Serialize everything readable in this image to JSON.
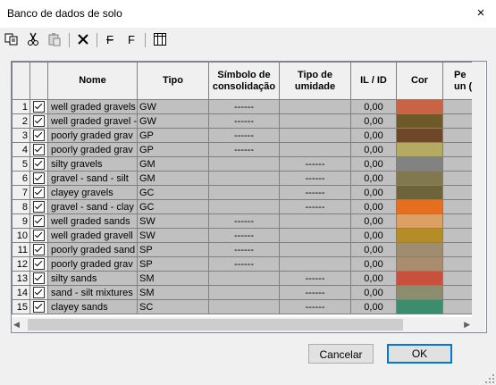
{
  "window": {
    "title": "Banco de dados de solo",
    "close_label": "×"
  },
  "toolbar": {
    "icons": [
      "copy-icon",
      "cut-icon",
      "paste-icon",
      "delete-icon",
      "filter-f-icon",
      "f-icon",
      "columns-icon"
    ],
    "f_label_1": "F",
    "f_label_2": "F"
  },
  "grid": {
    "headers": [
      "Nome",
      "Tipo",
      "Símbolo de consolidação",
      "Tipo de umidade",
      "IL / ID",
      "Cor",
      "Pe un (k"
    ],
    "rows": [
      {
        "n": "1",
        "nome": "well graded gravels",
        "tipo": "GW",
        "simb": "------",
        "umid": "",
        "il": "0,00",
        "cor": "#c86445"
      },
      {
        "n": "2",
        "nome": "well graded gravel -",
        "tipo": "GW",
        "simb": "------",
        "umid": "",
        "il": "0,00",
        "cor": "#6e5a28"
      },
      {
        "n": "3",
        "nome": "poorly graded grav",
        "tipo": "GP",
        "simb": "------",
        "umid": "",
        "il": "0,00",
        "cor": "#6e4628"
      },
      {
        "n": "4",
        "nome": "poorly graded grav",
        "tipo": "GP",
        "simb": "------",
        "umid": "",
        "il": "0,00",
        "cor": "#b4aa64"
      },
      {
        "n": "5",
        "nome": "silty gravels",
        "tipo": "GM",
        "simb": "",
        "umid": "------",
        "il": "0,00",
        "cor": "#828282"
      },
      {
        "n": "6",
        "nome": "gravel - sand - silt",
        "tipo": "GM",
        "simb": "",
        "umid": "------",
        "il": "0,00",
        "cor": "#827850"
      },
      {
        "n": "7",
        "nome": "clayey gravels",
        "tipo": "GC",
        "simb": "",
        "umid": "------",
        "il": "0,00",
        "cor": "#6e643c"
      },
      {
        "n": "8",
        "nome": "gravel - sand - clay",
        "tipo": "GC",
        "simb": "",
        "umid": "------",
        "il": "0,00",
        "cor": "#e66e1e"
      },
      {
        "n": "9",
        "nome": "well graded sands",
        "tipo": "SW",
        "simb": "------",
        "umid": "",
        "il": "0,00",
        "cor": "#dca064"
      },
      {
        "n": "10",
        "nome": "well graded gravell",
        "tipo": "SW",
        "simb": "------",
        "umid": "",
        "il": "0,00",
        "cor": "#b48c28"
      },
      {
        "n": "11",
        "nome": "poorly graded sand",
        "tipo": "SP",
        "simb": "------",
        "umid": "",
        "il": "0,00",
        "cor": "#a08c6e"
      },
      {
        "n": "12",
        "nome": "poorly graded grav",
        "tipo": "SP",
        "simb": "------",
        "umid": "",
        "il": "0,00",
        "cor": "#aa8c6e"
      },
      {
        "n": "13",
        "nome": "silty sands",
        "tipo": "SM",
        "simb": "",
        "umid": "------",
        "il": "0,00",
        "cor": "#c8503c"
      },
      {
        "n": "14",
        "nome": "sand - silt mixtures",
        "tipo": "SM",
        "simb": "",
        "umid": "------",
        "il": "0,00",
        "cor": "#8c8c6e"
      },
      {
        "n": "15",
        "nome": "clayey sands",
        "tipo": "SC",
        "simb": "",
        "umid": "------",
        "il": "0,00",
        "cor": "#3c8c6e"
      }
    ]
  },
  "buttons": {
    "cancel": "Cancelar",
    "ok": "OK"
  }
}
